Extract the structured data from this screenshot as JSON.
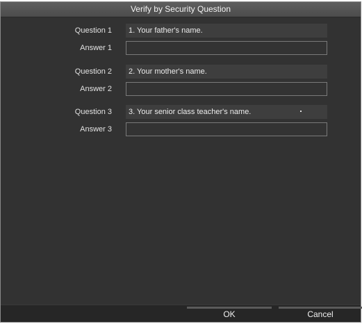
{
  "dialog": {
    "title": "Verify by Security Question"
  },
  "questions": [
    {
      "question_label": "Question 1",
      "question_text": "1. Your father's name.",
      "answer_label": "Answer 1",
      "answer_value": ""
    },
    {
      "question_label": "Question 2",
      "question_text": "2. Your mother's name.",
      "answer_label": "Answer 2",
      "answer_value": ""
    },
    {
      "question_label": "Question 3",
      "question_text": "3. Your senior class teacher's name.",
      "answer_label": "Answer 3",
      "answer_value": ""
    }
  ],
  "buttons": {
    "ok": "OK",
    "cancel": "Cancel"
  },
  "colors": {
    "background": "#323232",
    "titlebar": "#545454",
    "field": "#3e3e3e",
    "border": "#7a7a7a"
  }
}
